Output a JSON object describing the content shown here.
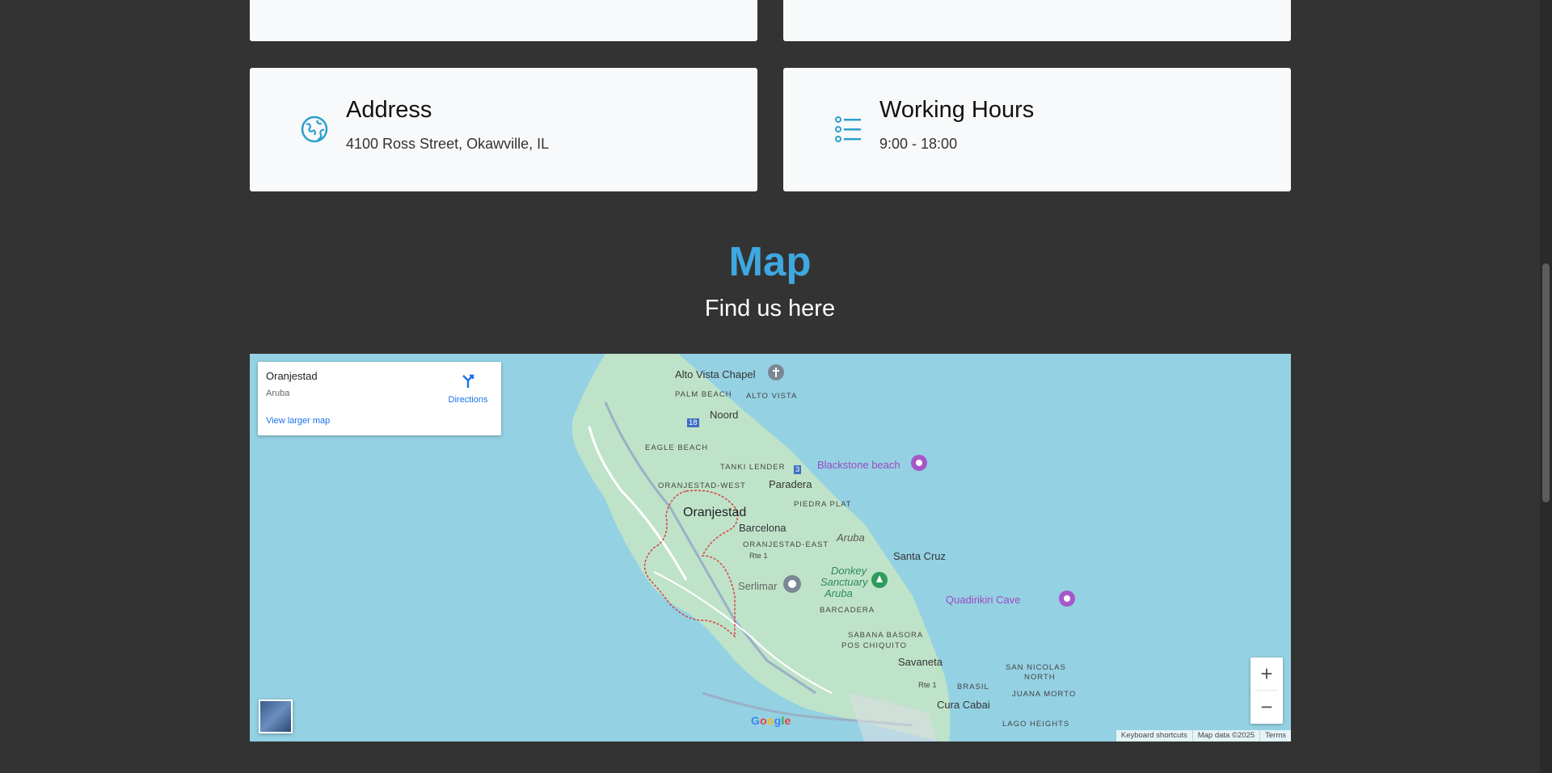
{
  "cards": {
    "address": {
      "title": "Address",
      "text": "4100 Ross Street, Okawville, IL",
      "icon": "globe-icon"
    },
    "hours": {
      "title": "Working Hours",
      "text": "9:00 - 18:00",
      "icon": "list-icon"
    }
  },
  "section": {
    "title": "Map",
    "subtitle": "Find us here"
  },
  "map": {
    "info": {
      "title": "Oranjestad",
      "subtitle": "Aruba",
      "directions": "Directions",
      "larger_link": "View larger map"
    },
    "zoom_in": "+",
    "zoom_out": "−",
    "google": "Google",
    "attribution": {
      "shortcuts": "Keyboard shortcuts",
      "data": "Map data ©2025",
      "terms": "Terms"
    },
    "labels": {
      "alto_vista": "Alto Vista Chapel",
      "palm_beach": "PALM BEACH",
      "alto_vista_area": "ALTO VISTA",
      "noord": "Noord",
      "route_18": "18",
      "eagle_beach": "EAGLE BEACH",
      "tanki_lender": "TANKI LENDER",
      "route_3": "3",
      "blackstone": "Blackstone beach",
      "oranjestad_west": "ORANJESTAD-WEST",
      "paradera": "Paradera",
      "piedra_plat": "PIEDRA PLAT",
      "oranjestad": "Oranjestad",
      "barcelona": "Barcelona",
      "aruba": "Aruba",
      "oranjestad_east": "ORANJESTAD-EAST",
      "rte1": "Rte 1",
      "santa_cruz": "Santa Cruz",
      "donkey1": "Donkey",
      "donkey2": "Sanctuary",
      "donkey3": "Aruba",
      "serlimar": "Serlimar",
      "quadirikiri": "Quadirikiri Cave",
      "barcadera": "BARCADERA",
      "sabana_basora": "SABANA BASORA",
      "pos_chiquito": "POS CHIQUITO",
      "savaneta": "Savaneta",
      "san_nicolas1": "SAN NICOLAS",
      "san_nicolas2": "NORTH",
      "rte1b": "Rte 1",
      "brasil": "BRASIL",
      "juana_morto": "JUANA MORTO",
      "cura_cabai": "Cura Cabai",
      "lago_heights": "LAGO HEIGHTS"
    }
  },
  "colors": {
    "accent": "#3ea8e0",
    "background": "#333333",
    "card": "#f8f9fa",
    "water": "#94d1e3",
    "land": "#bfe3c9"
  }
}
